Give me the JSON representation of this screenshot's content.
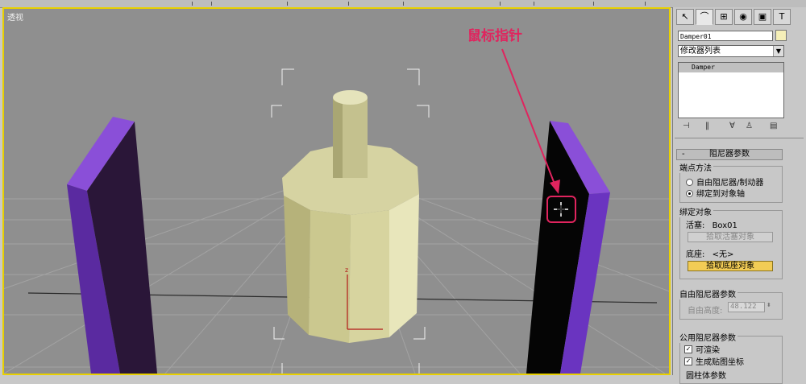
{
  "viewport": {
    "label": "透视"
  },
  "annotation": {
    "text": "鼠标指针",
    "color": "#e0245e"
  },
  "panel": {
    "tabs": [
      "create-icon",
      "modify-icon",
      "hierarchy-icon",
      "motion-icon",
      "display-icon",
      "utilities-icon"
    ],
    "object_name": "Damper01",
    "object_color": "#f5efb8",
    "modifier_list": "修改器列表",
    "stack_item": "Damper",
    "rollout_title": "阻尼器参数",
    "rollout_collapse": "-",
    "endpoint_method": {
      "title": "端点方法",
      "option1": "自由阻尼器/制动器",
      "option2": "绑定到对象轴",
      "selected": "绑定到对象轴"
    },
    "bind_objects": {
      "title": "绑定对象",
      "piston_label": "活塞:",
      "piston_value": "Box01",
      "pick_piston": "拾取活塞对象",
      "base_label": "底座:",
      "base_value": "<无>",
      "pick_base": "拾取底座对象"
    },
    "free_params": {
      "title": "自由阻尼器参数",
      "height_label": "自由高度:",
      "height_value": "48.122"
    },
    "common_params": {
      "title": "公用阻尼器参数",
      "renderable": "可渲染",
      "gen_mapping": "生成贴图坐标",
      "next_title": "圆柱体参数"
    }
  }
}
